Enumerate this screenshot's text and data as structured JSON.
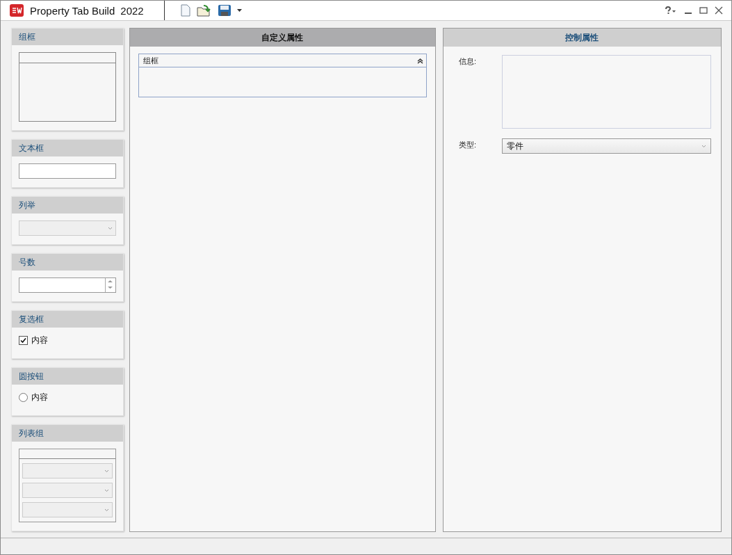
{
  "window": {
    "app_name": "Property Tab Build",
    "version": "2022"
  },
  "palette": [
    {
      "kind": "groupbox",
      "title": "组框"
    },
    {
      "kind": "textbox",
      "title": "文本框"
    },
    {
      "kind": "combobox",
      "title": "列举",
      "disabled": true
    },
    {
      "kind": "spinner",
      "title": "号数"
    },
    {
      "kind": "checkbox",
      "title": "复选框",
      "label": "内容",
      "checked": true
    },
    {
      "kind": "radio",
      "title": "圆按钮",
      "label": "内容",
      "selected": false
    },
    {
      "kind": "listgroup",
      "title": "列表组"
    }
  ],
  "custom_properties": {
    "title": "自定义属性",
    "group": {
      "title": "组框",
      "expanded": true
    }
  },
  "control_properties": {
    "title": "控制属性",
    "fields": [
      {
        "kind": "textarea",
        "label": "信息:"
      },
      {
        "kind": "select",
        "label": "类型:",
        "value": "零件"
      }
    ]
  }
}
